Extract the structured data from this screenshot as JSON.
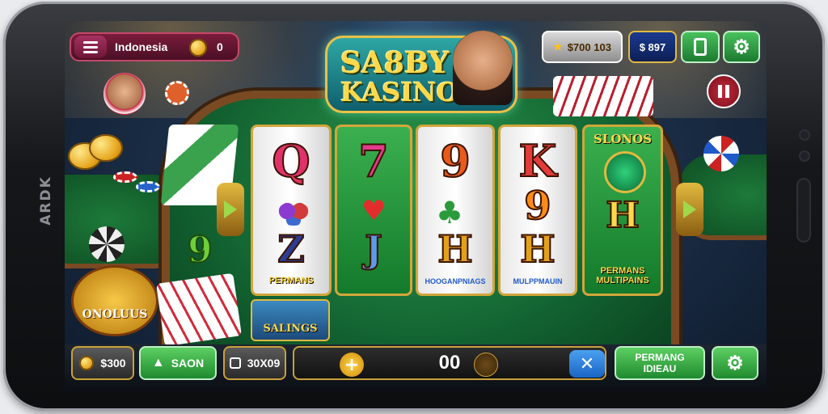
{
  "device": {
    "brand": "ARDK"
  },
  "header": {
    "region": "Indonesia",
    "coins": "0",
    "balance_chip": "$700 103",
    "score_chip": "$ 897"
  },
  "logo": {
    "line1": "SA8BY",
    "line2": "KASINO"
  },
  "reels": [
    {
      "top": "Q",
      "middle": "grapes",
      "bottom": "Z",
      "caption": "PERMANS",
      "color": "#e0316a"
    },
    {
      "top": "7",
      "middle": "heart",
      "bottom": "J",
      "caption": "",
      "color": "#e23b8c"
    },
    {
      "top": "9",
      "middle": "clover",
      "bottom": "H",
      "caption": "HOOGANPNIAGS",
      "color": "#e85b1a"
    },
    {
      "top": "K",
      "middle": "9",
      "bottom": "H",
      "caption": "MULPPMAUIN",
      "color": "#e23b3b"
    },
    {
      "top": "SLONOS",
      "middle": "emerald",
      "bottom": "H",
      "caption": "PERMANS MULTIPAINS",
      "color": "#ffd84a"
    }
  ],
  "side": {
    "left_symbol": "9",
    "bonus_label": "SALINGS",
    "badge_label": "ONOLUUS"
  },
  "bottom": {
    "bet": "$300",
    "spin_label": "SAON",
    "auto_label": "30X09",
    "stake_value": "00",
    "promo_label_1": "PERMANG",
    "promo_label_2": "IDIEAU"
  },
  "colors": {
    "felt": "#1a7a3a",
    "wood": "#7a4a22",
    "gold": "#e2b93f",
    "green_btn": "#2fa34a",
    "blue_btn": "#1f7ad6"
  }
}
